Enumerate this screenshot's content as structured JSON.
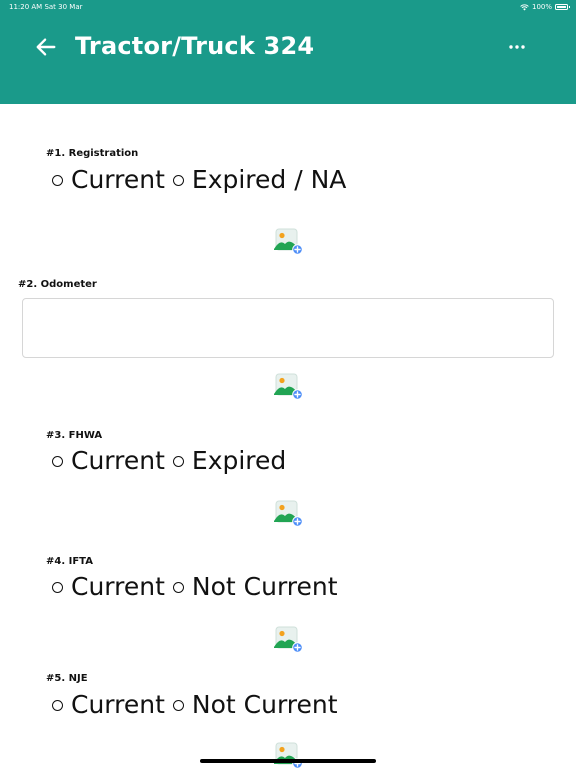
{
  "status_bar": {
    "time": "11:20 AM  Sat 30 Mar",
    "battery": "100%"
  },
  "header": {
    "title": "Tractor/Truck 324",
    "back_icon": "arrow-left-icon",
    "more_icon": "more-horizontal-icon"
  },
  "colors": {
    "header_bg": "#1a9a8a",
    "text": "#111111",
    "input_border": "#d6d6d6",
    "icon_green": "#21a453",
    "icon_blue": "#4e8ef7",
    "icon_sun": "#f3a21d"
  },
  "questions": [
    {
      "label": "#1. Registration",
      "type": "radio",
      "options": [
        "Current",
        "Expired / NA"
      ]
    },
    {
      "label": "#2. Odometer",
      "type": "text",
      "value": "",
      "placeholder": ""
    },
    {
      "label": "#3. FHWA",
      "type": "radio",
      "options": [
        "Current",
        "Expired"
      ]
    },
    {
      "label": "#4. IFTA",
      "type": "radio",
      "options": [
        "Current",
        "Not Current"
      ]
    },
    {
      "label": "#5. NJE",
      "type": "radio",
      "options": [
        "Current",
        "Not Current"
      ]
    }
  ],
  "add_photo_icon": "add-photo-icon"
}
